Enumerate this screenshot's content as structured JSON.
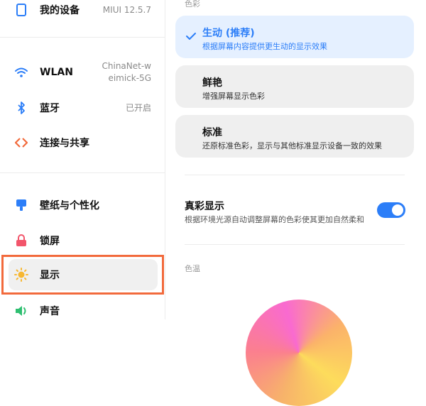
{
  "sidebar": {
    "device": {
      "label": "我的设备",
      "value": "MIUI 12.5.7"
    },
    "wlan": {
      "label": "WLAN",
      "value_line1": "ChinaNet-w",
      "value_line2": "eimick-5G"
    },
    "bluetooth": {
      "label": "蓝牙",
      "value": "已开启"
    },
    "connect": {
      "label": "连接与共享"
    },
    "wallpaper": {
      "label": "壁纸与个性化"
    },
    "lockscreen": {
      "label": "锁屏"
    },
    "display": {
      "label": "显示",
      "selected": true
    },
    "sound": {
      "label": "声音"
    }
  },
  "main": {
    "color_section_label": "色彩",
    "options": [
      {
        "title": "生动 (推荐)",
        "desc": "根据屏幕内容提供更生动的显示效果",
        "selected": true
      },
      {
        "title": "鲜艳",
        "desc": "增强屏幕显示色彩",
        "selected": false
      },
      {
        "title": "标准",
        "desc": "还原标准色彩，显示与其他标准显示设备一致的效果",
        "selected": false
      }
    ],
    "true_color": {
      "title": "真彩显示",
      "desc": "根据环境光源自动调整屏幕的色彩使其更加自然柔和",
      "enabled": true
    },
    "temperature_section_label": "色温"
  },
  "colors": {
    "accent": "#2c7ef8",
    "highlight_border": "#f26a3c"
  }
}
